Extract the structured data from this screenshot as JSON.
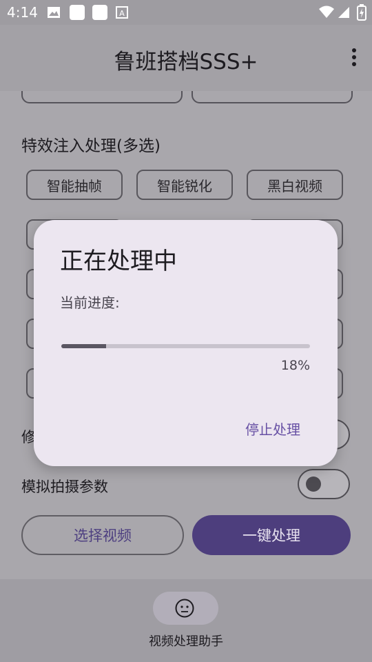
{
  "status_bar": {
    "time": "4:14",
    "icons": [
      "image-icon",
      "app-icon",
      "app-icon",
      "a-icon",
      "wifi-icon",
      "signal-icon",
      "battery-charging-icon"
    ]
  },
  "app_bar": {
    "title": "鲁班搭档SSS+"
  },
  "effects": {
    "section_title": "特效注入处理(多选)",
    "chips": [
      "智能抽帧",
      "智能锐化",
      "黑白视频"
    ]
  },
  "toggles": [
    {
      "label": "修",
      "on": false
    },
    {
      "label": "模拟拍摄参数",
      "on": false
    }
  ],
  "buttons": {
    "select_video": "选择视频",
    "one_click": "一键处理"
  },
  "bottom_nav": {
    "label": "视频处理助手",
    "icon": "face-icon"
  },
  "dialog": {
    "title": "正在处理中",
    "progress_label": "当前进度:",
    "progress": 0.18,
    "percent_text": "18%",
    "stop_label": "停止处理"
  },
  "colors": {
    "accent": "#4d3e7d",
    "dialog_bg": "#ece6f0",
    "text_button": "#6750a4"
  }
}
